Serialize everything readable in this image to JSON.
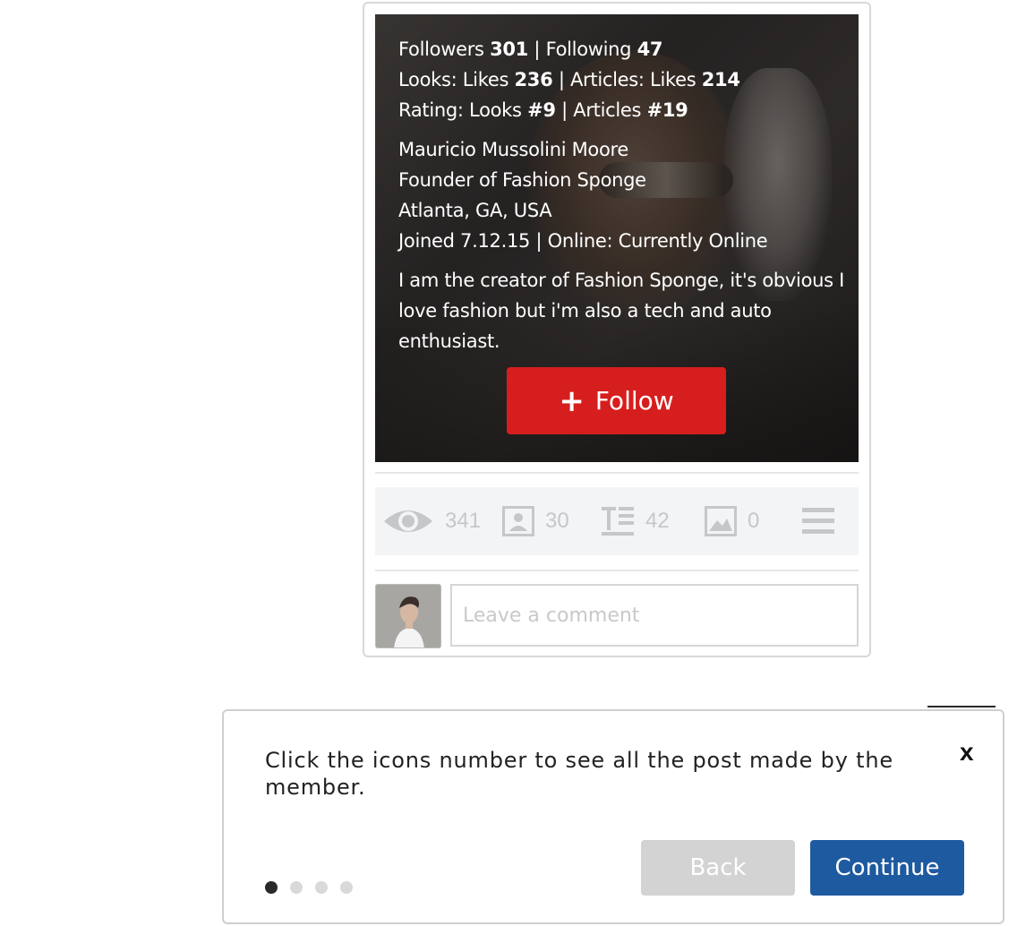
{
  "profile": {
    "followers_label": "Followers",
    "followers": "301",
    "following_label": "Following",
    "following": "47",
    "looks_likes_label": "Looks: Likes",
    "looks_likes": "236",
    "articles_likes_label": "Articles: Likes",
    "articles_likes": "214",
    "rating_looks_label": "Rating: Looks",
    "rating_looks": "#9",
    "rating_articles_label": "Articles",
    "rating_articles": "#19",
    "name": "Mauricio Mussolini Moore",
    "title": "Founder of Fashion Sponge",
    "location": "Atlanta, GA, USA",
    "joined": "Joined 7.12.15 | Online: Currently Online",
    "bio": "I am the creator of Fashion Sponge, it's obvious I love fashion but i'm also a tech and auto enthusiast.",
    "follow_label": "Follow",
    "separator": "|"
  },
  "stats": {
    "views": "341",
    "looks": "30",
    "articles": "42",
    "photos": "0"
  },
  "comment": {
    "placeholder": "Leave a comment"
  },
  "tooltip": {
    "text": "Click the icons number to see all the post made by the member.",
    "close": "x",
    "back_label": "Back",
    "continue_label": "Continue",
    "steps_total": 4,
    "step_active": 1
  },
  "colors": {
    "follow_red": "#d71e1e",
    "continue_blue": "#1e5aa0",
    "back_gray": "#d3d3d3",
    "stat_icon_gray": "#c5c7c9"
  }
}
